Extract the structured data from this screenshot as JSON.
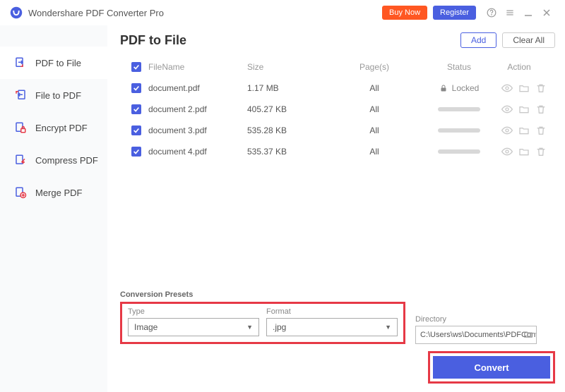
{
  "titlebar": {
    "title": "Wondershare PDF Converter Pro",
    "buy": "Buy Now",
    "register": "Register"
  },
  "sidebar": {
    "items": [
      {
        "label": "PDF to File"
      },
      {
        "label": "File to PDF"
      },
      {
        "label": "Encrypt PDF"
      },
      {
        "label": "Compress PDF"
      },
      {
        "label": "Merge PDF"
      }
    ]
  },
  "page": {
    "title": "PDF to File",
    "add": "Add",
    "clear": "Clear All"
  },
  "table": {
    "headers": {
      "name": "FileName",
      "size": "Size",
      "pages": "Page(s)",
      "status": "Status",
      "action": "Action"
    },
    "rows": [
      {
        "name": "document.pdf",
        "size": "1.17 MB",
        "pages": "All",
        "locked": true,
        "locked_label": "Locked"
      },
      {
        "name": "document 2.pdf",
        "size": "405.27 KB",
        "pages": "All",
        "locked": false
      },
      {
        "name": "document 3.pdf",
        "size": "535.28 KB",
        "pages": "All",
        "locked": false
      },
      {
        "name": "document 4.pdf",
        "size": "535.37 KB",
        "pages": "All",
        "locked": false
      }
    ]
  },
  "presets": {
    "section_label": "Conversion Presets",
    "type_label": "Type",
    "type_value": "Image",
    "format_label": "Format",
    "format_value": ".jpg",
    "directory_label": "Directory",
    "directory_value": "C:\\Users\\ws\\Documents\\PDFConvert"
  },
  "convert_label": "Convert"
}
